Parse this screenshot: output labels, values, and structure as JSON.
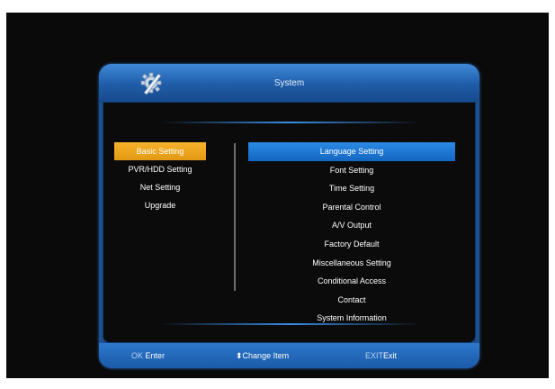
{
  "window": {
    "title": "System",
    "icon": "settings-gear-icon"
  },
  "left_menu": {
    "items": [
      {
        "label": "Basic Setting",
        "selected": true
      },
      {
        "label": "PVR/HDD Setting",
        "selected": false
      },
      {
        "label": "Net Setting",
        "selected": false
      },
      {
        "label": "Upgrade",
        "selected": false
      }
    ]
  },
  "right_menu": {
    "items": [
      {
        "label": "Language Setting",
        "selected": true
      },
      {
        "label": "Font Setting",
        "selected": false
      },
      {
        "label": "Time Setting",
        "selected": false
      },
      {
        "label": "Parental Control",
        "selected": false
      },
      {
        "label": "A/V Output",
        "selected": false
      },
      {
        "label": "Factory Default",
        "selected": false
      },
      {
        "label": "Miscellaneous Setting",
        "selected": false
      },
      {
        "label": "Conditional Access",
        "selected": false
      },
      {
        "label": "Contact",
        "selected": false
      },
      {
        "label": "System Information",
        "selected": false
      }
    ]
  },
  "footer": {
    "ok_key": "OK",
    "ok_label": "Enter",
    "nav_icon": "up-down-arrow-icon",
    "nav_label": "Change Item",
    "exit_key": "EXIT",
    "exit_label": "Exit"
  },
  "colors": {
    "dialog_blue": "#1b4f8e",
    "highlight_orange": "#f0a820",
    "highlight_blue": "#1f78d6",
    "background": "#0b0b0b"
  }
}
